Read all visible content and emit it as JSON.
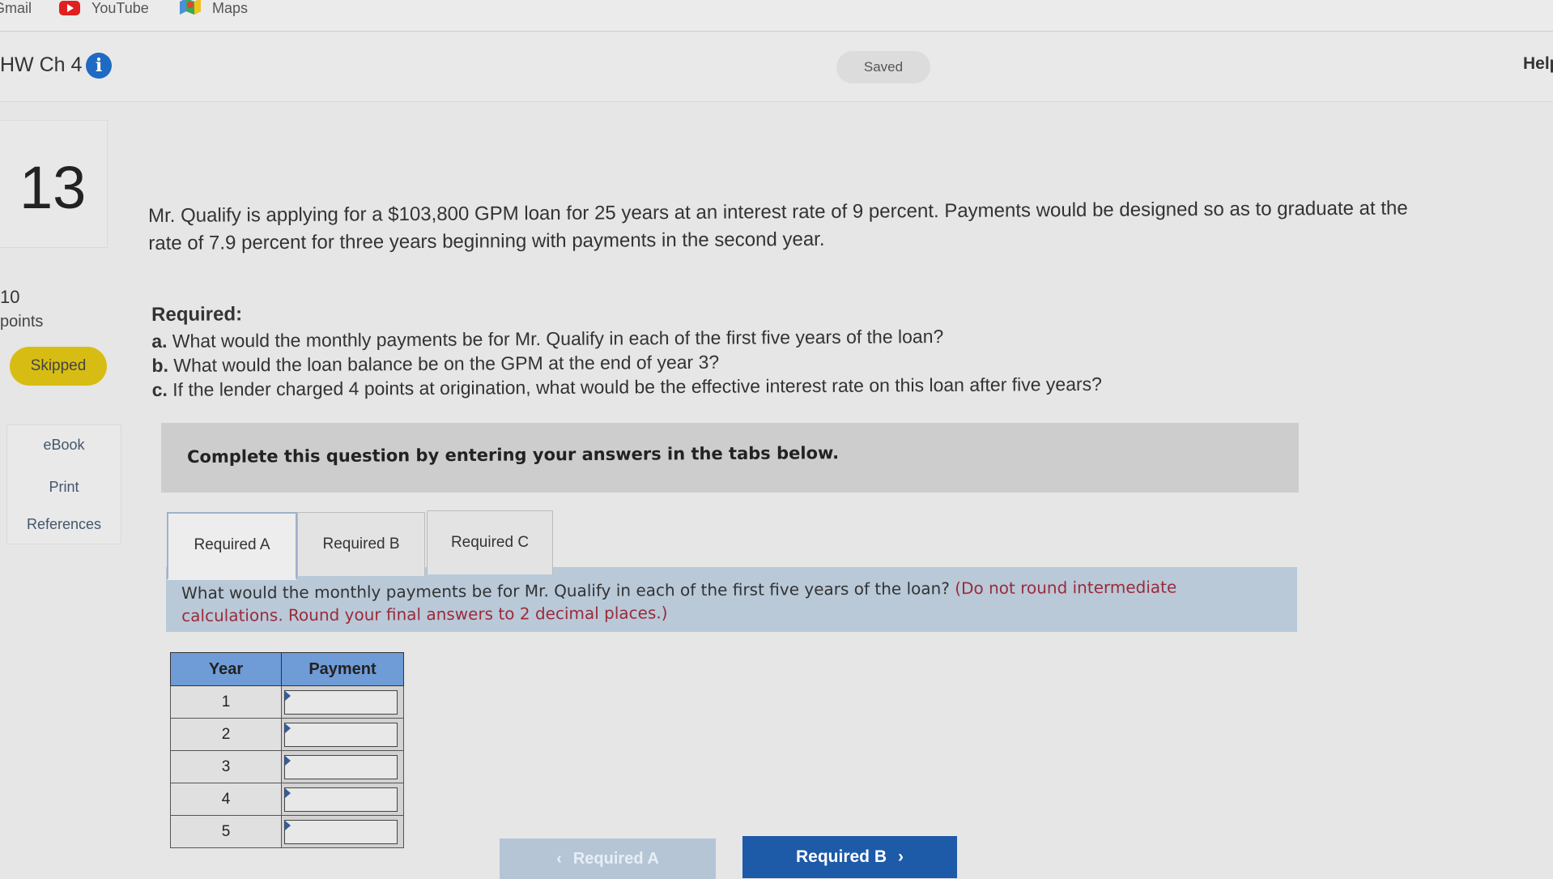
{
  "bookmarks": [
    {
      "label": "Gmail",
      "icon": "gmail-icon"
    },
    {
      "label": "YouTube",
      "icon": "youtube-icon"
    },
    {
      "label": "Maps",
      "icon": "maps-icon"
    }
  ],
  "header": {
    "title": "HW Ch 4",
    "info_icon": "info-icon",
    "status": "Saved",
    "help": "Help"
  },
  "sidebar": {
    "question_number": "13",
    "points_value": "10",
    "points_label": "points",
    "status_badge": "Skipped",
    "tools": [
      "eBook",
      "Print",
      "References"
    ]
  },
  "question": {
    "text": "Mr. Qualify is applying for a $103,800 GPM loan for 25 years at an interest rate of 9 percent. Payments would be designed so as to graduate at the rate of 7.9 percent for three years beginning with payments in the second year.",
    "required_heading": "Required:",
    "items": [
      {
        "letter": "a.",
        "text": "What would the monthly payments be for Mr. Qualify in each of the first five years of the loan?"
      },
      {
        "letter": "b.",
        "text": "What would the loan balance be on the GPM at the end of year 3?"
      },
      {
        "letter": "c.",
        "text": "If the lender charged 4 points at origination, what would be the effective interest rate on this loan after five years?"
      }
    ]
  },
  "instructions": "Complete this question by entering your answers in the tabs below.",
  "tabs": [
    "Required A",
    "Required B",
    "Required C"
  ],
  "active_tab": "Required A",
  "prompt": {
    "text": "What would the monthly payments be for Mr. Qualify in each of the first five years of the loan?",
    "note": "(Do not round intermediate calculations. Round your final answers to 2 decimal places.)"
  },
  "table": {
    "headers": [
      "Year",
      "Payment"
    ],
    "rows": [
      {
        "year": "1",
        "payment": ""
      },
      {
        "year": "2",
        "payment": ""
      },
      {
        "year": "3",
        "payment": ""
      },
      {
        "year": "4",
        "payment": ""
      },
      {
        "year": "5",
        "payment": ""
      }
    ]
  },
  "nav": {
    "prev": "Required A",
    "next": "Required B"
  },
  "colors": {
    "accent_blue": "#1d5aa8",
    "table_header": "#6f9cd6",
    "skipped_badge": "#d7bd13",
    "note_red": "#9b2a3a"
  }
}
